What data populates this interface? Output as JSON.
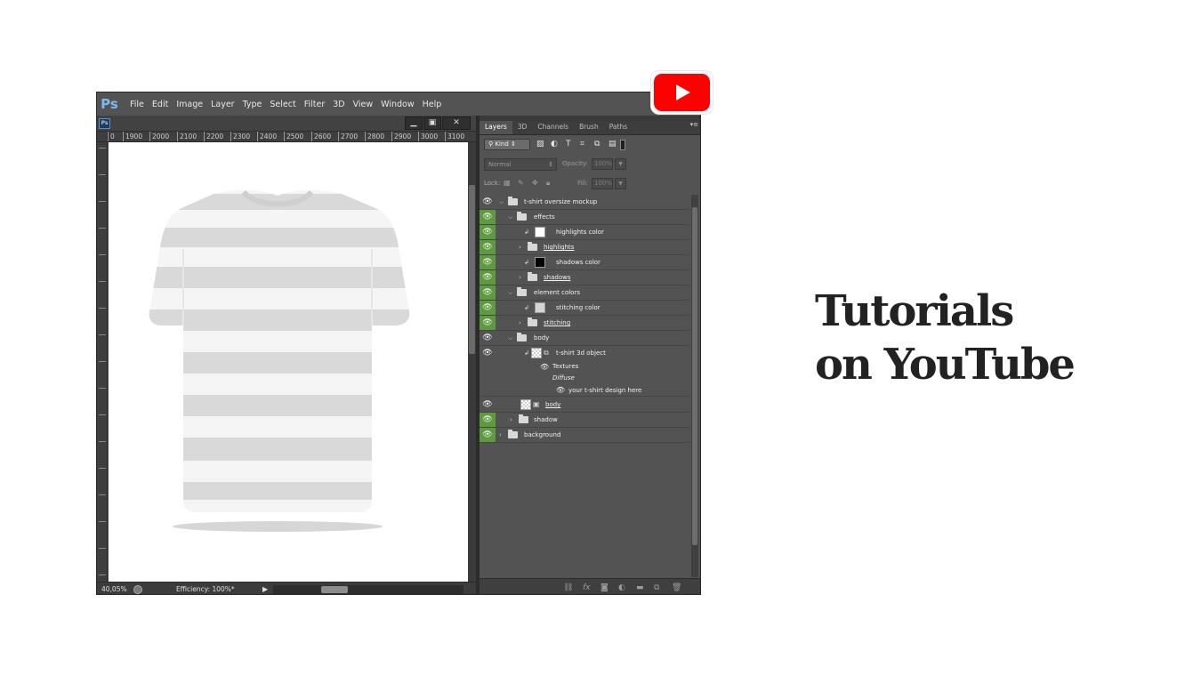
{
  "app": {
    "logo": "Ps",
    "menu": [
      "File",
      "Edit",
      "Image",
      "Layer",
      "Type",
      "Select",
      "Filter",
      "3D",
      "View",
      "Window",
      "Help"
    ]
  },
  "document": {
    "title_icon": "Ps",
    "window_controls": [
      "minimize-icon",
      "maximize-icon",
      "close-icon"
    ],
    "ruler_labels": [
      "0",
      "1900",
      "2000",
      "2100",
      "2200",
      "2300",
      "2400",
      "2500",
      "2600",
      "2700",
      "2800",
      "2900",
      "3000",
      "3100"
    ],
    "zoom": "40,05%",
    "status": "Efficiency: 100%*"
  },
  "layers_panel": {
    "tabs": [
      "Layers",
      "3D",
      "Channels",
      "Brush",
      "Paths"
    ],
    "active_tab": "Layers",
    "filter_kind": "Kind",
    "blend_mode": "Normal",
    "opacity_label": "Opacity:",
    "opacity_value": "100%",
    "lock_label": "Lock:",
    "fill_label": "Fill:",
    "fill_value": "100%",
    "layers": [
      {
        "name": "t-shirt oversize mockup",
        "type": "group"
      },
      {
        "name": "effects",
        "type": "group"
      },
      {
        "name": "highlights color",
        "type": "fill"
      },
      {
        "name": "highlights",
        "type": "group"
      },
      {
        "name": "shadows color",
        "type": "fill"
      },
      {
        "name": "shadows",
        "type": "group"
      },
      {
        "name": "element colors",
        "type": "group"
      },
      {
        "name": "stitching color",
        "type": "fill"
      },
      {
        "name": "stitching",
        "type": "group"
      },
      {
        "name": "body",
        "type": "group"
      },
      {
        "name": "t-shirt 3d object",
        "type": "smart-object"
      },
      {
        "name": "Textures",
        "type": "sub"
      },
      {
        "name": "Diffuse",
        "type": "sub"
      },
      {
        "name": "your t-shirt design here",
        "type": "sub"
      },
      {
        "name": "body",
        "type": "layer"
      },
      {
        "name": "shadow",
        "type": "group"
      },
      {
        "name": "background",
        "type": "group"
      }
    ]
  },
  "colors": {
    "youtube_red": "#ff0000",
    "photoshop_blue": "#7cb8f2",
    "visibility_green": "#5e9b3e"
  },
  "headline": {
    "line1": "Tutorials",
    "line2": "on YouTube"
  }
}
